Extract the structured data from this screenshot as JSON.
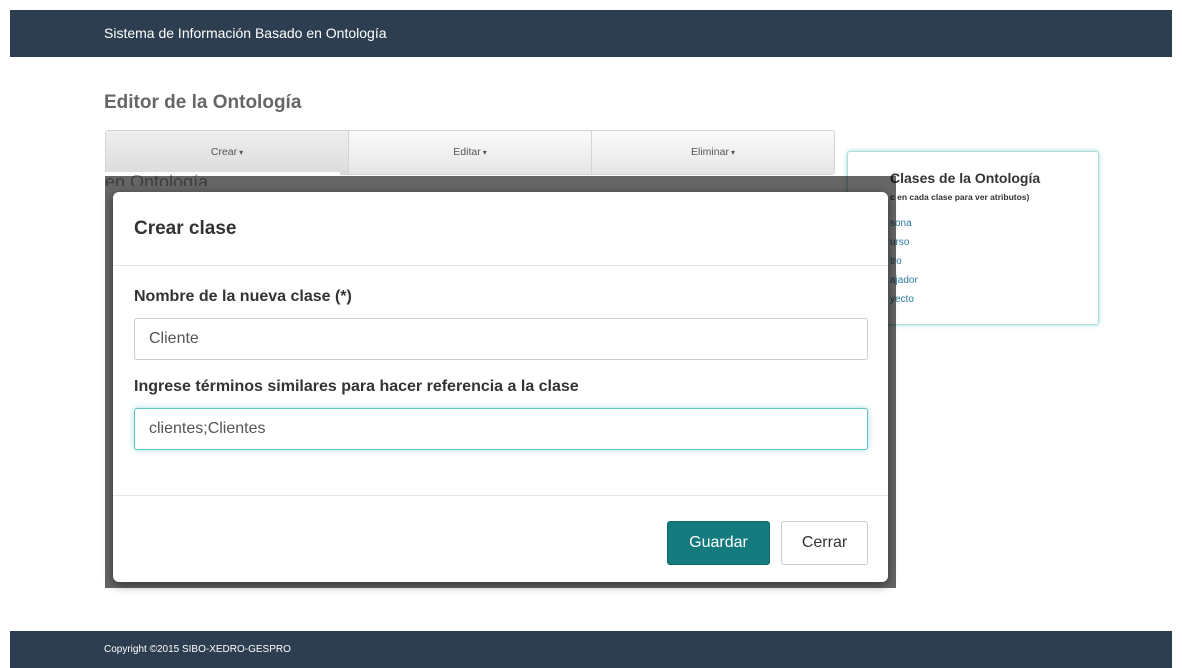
{
  "navbar": {
    "brand": "Sistema de Información Basado en Ontología"
  },
  "page": {
    "title": "Editor de la Ontología"
  },
  "toolbar": {
    "caret": "▾",
    "items": [
      {
        "label": "Crear"
      },
      {
        "label": "Editar"
      },
      {
        "label": "Eliminar"
      }
    ]
  },
  "panel": {
    "title": "Clases de la Ontología",
    "hint": "c en cada clase para ver atributos)",
    "classes": [
      "sona",
      "urso",
      "tro",
      "ajador",
      "yecto"
    ]
  },
  "background_ghost_text": "en Ontología",
  "modal": {
    "title": "Crear clase",
    "name_label": "Nombre de la nueva clase (*)",
    "name_value": "Cliente",
    "synonyms_label": "Ingrese términos similares para hacer referencia a la clase",
    "synonyms_value": "clientes;Clientes",
    "save_label": "Guardar",
    "close_label": "Cerrar"
  },
  "footer": {
    "copyright": "Copyright ©2015 SIBO-XEDRO-GESPRO"
  },
  "colors": {
    "navbar": "#2c3e50",
    "primary": "#137b7e",
    "link": "#2a7a9e",
    "focus": "#66c3c3"
  }
}
